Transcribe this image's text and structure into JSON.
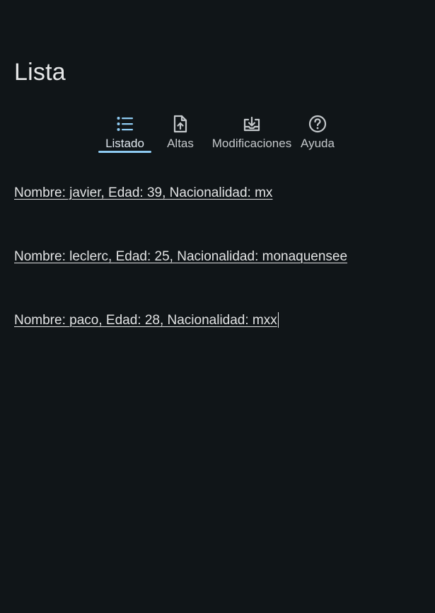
{
  "page": {
    "title": "Lista"
  },
  "tabs": [
    {
      "label": "Listado",
      "icon": "list-icon",
      "active": true
    },
    {
      "label": "Altas",
      "icon": "file-upload-icon",
      "active": false
    },
    {
      "label": "Modificaciones",
      "icon": "tray-download-icon",
      "active": false
    },
    {
      "label": "Ayuda",
      "icon": "help-circle-icon",
      "active": false
    }
  ],
  "records": [
    {
      "text": "Nombre: javier, Edad: 39, Nacionalidad: mx"
    },
    {
      "text": "Nombre: leclerc, Edad: 25, Nacionalidad: monaquensee"
    },
    {
      "text": "Nombre: paco, Edad: 28, Nacionalidad: mxx"
    }
  ],
  "colors": {
    "background": "#101518",
    "accent": "#8ecbf2",
    "text": "#e2e3e4"
  }
}
